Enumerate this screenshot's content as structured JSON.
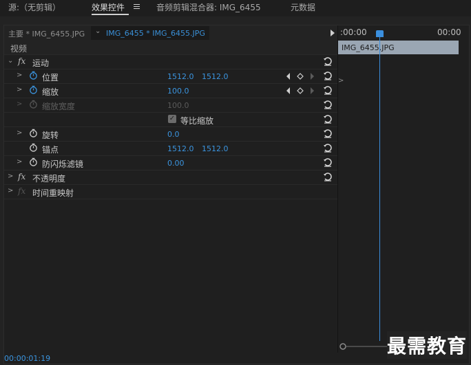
{
  "tabs": [
    {
      "label": "源:（无剪辑）"
    },
    {
      "label": "效果控件"
    },
    {
      "label": "音频剪辑混合器: IMG_6455"
    },
    {
      "label": "元数据"
    }
  ],
  "source_bar": {
    "master_label": "主要 * IMG_6455.JPG",
    "clip_label": "IMG_6455 * IMG_6455.JPG"
  },
  "timeline": {
    "start": ":00:00",
    "end": "00:00",
    "clip_name": "IMG_6455.JPG"
  },
  "section_video": "视频",
  "effects": {
    "motion": {
      "label": "运动",
      "position": {
        "label": "位置",
        "x": "1512.0",
        "y": "1512.0"
      },
      "scale": {
        "label": "缩放",
        "value": "100.0"
      },
      "scale_width": {
        "label": "缩放宽度",
        "value": "100.0"
      },
      "uniform_scale": {
        "label": "等比缩放",
        "checked": true
      },
      "rotation": {
        "label": "旋转",
        "value": "0.0"
      },
      "anchor": {
        "label": "锚点",
        "x": "1512.0",
        "y": "1512.0"
      },
      "anti_flicker": {
        "label": "防闪烁滤镜",
        "value": "0.00"
      }
    },
    "opacity": {
      "label": "不透明度"
    },
    "time_remap": {
      "label": "时间重映射"
    }
  },
  "timecode": "00:00:01:19",
  "watermark": "最需教育",
  "colors": {
    "accent": "#3b95e0",
    "background": "#232323"
  },
  "icons": [
    "stopwatch-icon",
    "reset-icon",
    "keyframe-nav-icon",
    "chevron-right-icon",
    "menu-icon",
    "play-icon"
  ]
}
